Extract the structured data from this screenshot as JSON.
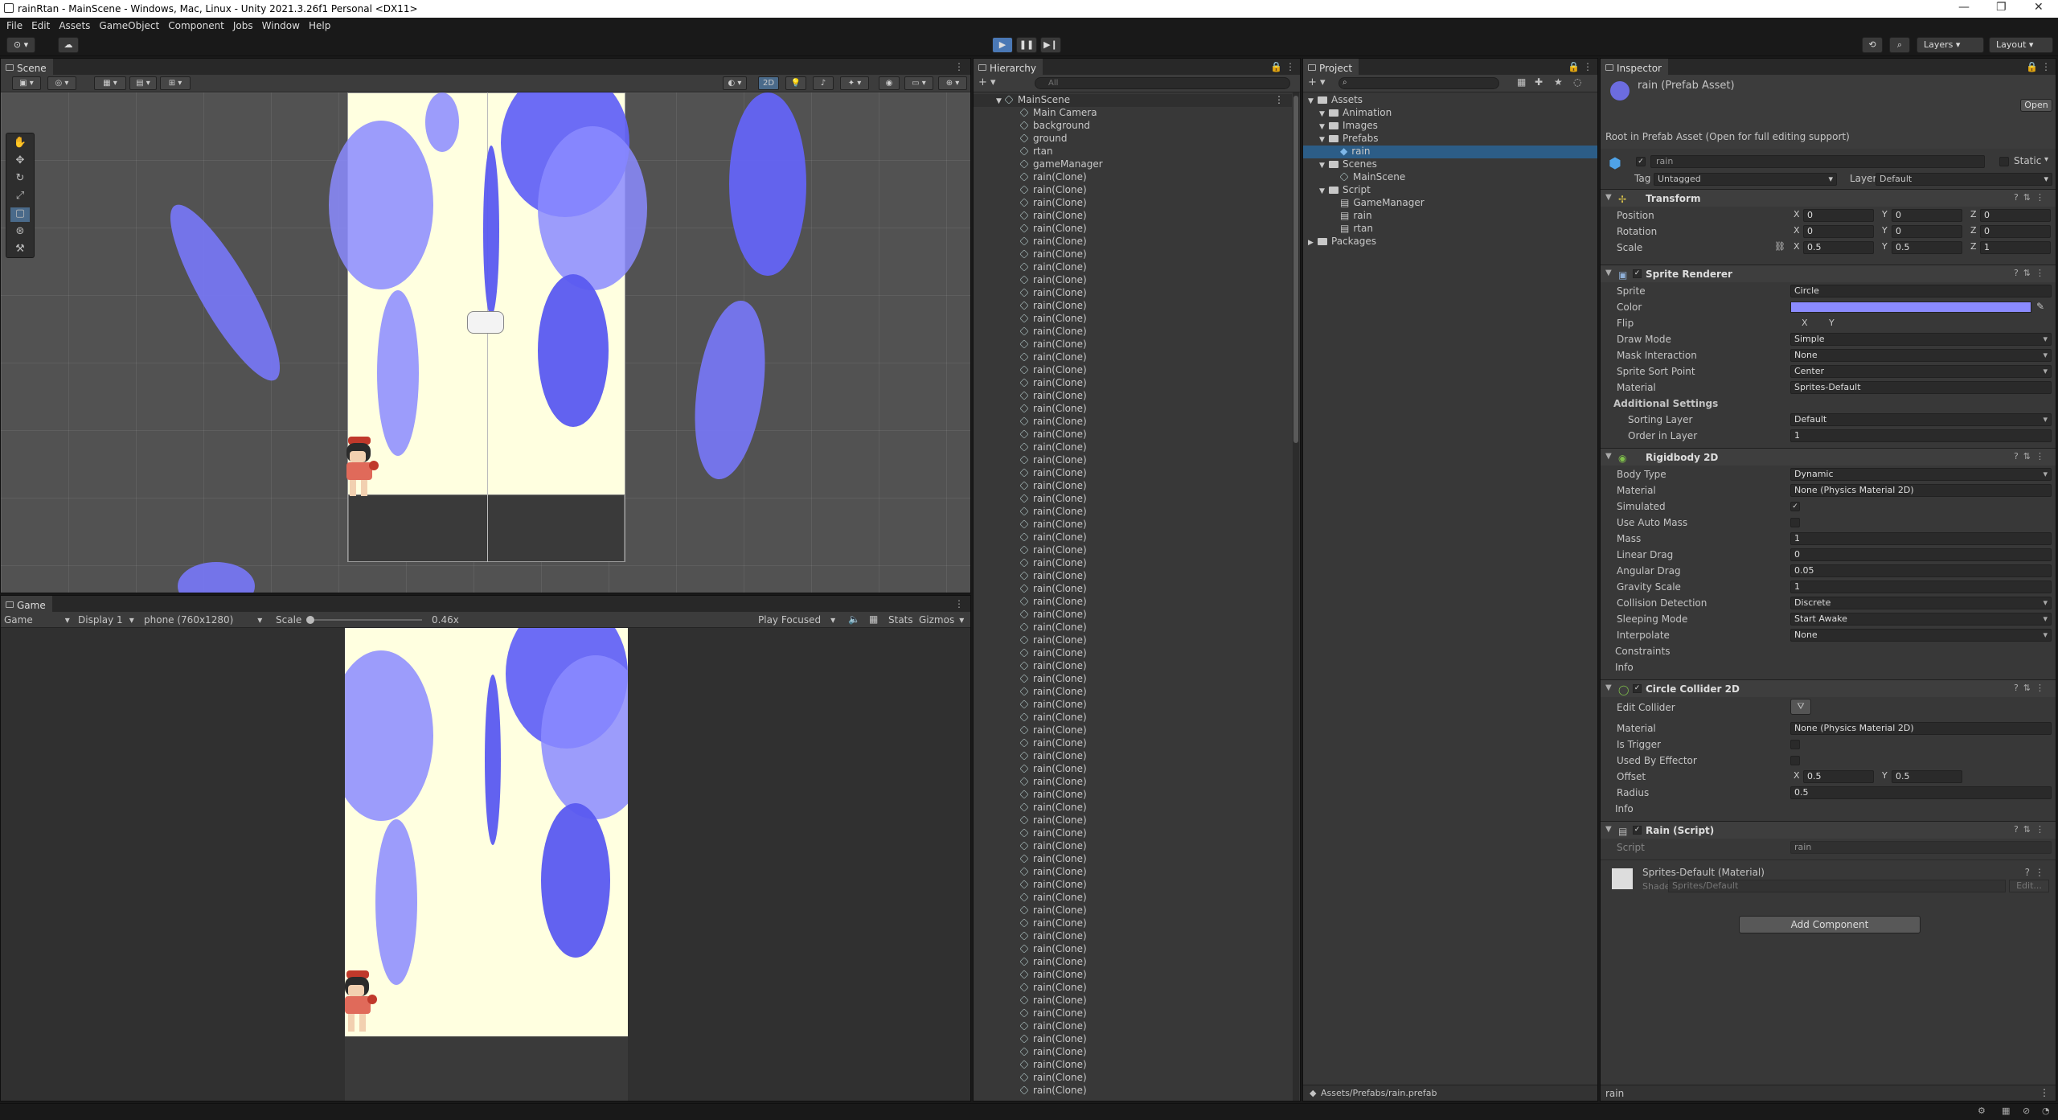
{
  "window": {
    "title": "rainRtan - MainScene - Windows, Mac, Linux - Unity 2021.3.26f1 Personal <DX11>"
  },
  "menu": [
    "File",
    "Edit",
    "Assets",
    "GameObject",
    "Component",
    "Jobs",
    "Window",
    "Help"
  ],
  "toolbar": {
    "layers": "Layers",
    "layout": "Layout"
  },
  "scene": {
    "tab": "Scene",
    "mode2d": "2D"
  },
  "game": {
    "tab": "Game",
    "view": "Game",
    "display": "Display 1",
    "resolution": "phone (760x1280)",
    "scale_label": "Scale",
    "scale_value": "0.46x",
    "play_mode": "Play Focused",
    "stats": "Stats",
    "gizmos": "Gizmos"
  },
  "hierarchy": {
    "tab": "Hierarchy",
    "search_placeholder": "All",
    "scene": "MainScene",
    "items": [
      "Main Camera",
      "background",
      "ground",
      "rtan",
      "gameManager"
    ],
    "clone_label": "rain(Clone)",
    "clone_count": 72
  },
  "project": {
    "tab": "Project",
    "tree": [
      {
        "label": "Assets",
        "depth": 0,
        "kind": "folder"
      },
      {
        "label": "Animation",
        "depth": 1,
        "kind": "folder"
      },
      {
        "label": "Images",
        "depth": 1,
        "kind": "folder"
      },
      {
        "label": "Prefabs",
        "depth": 1,
        "kind": "folder"
      },
      {
        "label": "rain",
        "depth": 2,
        "kind": "prefab",
        "selected": true
      },
      {
        "label": "Scenes",
        "depth": 1,
        "kind": "folder"
      },
      {
        "label": "MainScene",
        "depth": 2,
        "kind": "scene"
      },
      {
        "label": "Script",
        "depth": 1,
        "kind": "folder"
      },
      {
        "label": "GameManager",
        "depth": 2,
        "kind": "script"
      },
      {
        "label": "rain",
        "depth": 2,
        "kind": "script"
      },
      {
        "label": "rtan",
        "depth": 2,
        "kind": "script"
      },
      {
        "label": "Packages",
        "depth": 0,
        "kind": "folder"
      }
    ],
    "path": "Assets/Prefabs/rain.prefab"
  },
  "inspector": {
    "tab": "Inspector",
    "asset_title": "rain (Prefab Asset)",
    "open_btn": "Open",
    "root_note": "Root in Prefab Asset (Open for full editing support)",
    "name": "rain",
    "static_label": "Static",
    "tag_label": "Tag",
    "tag": "Untagged",
    "layer_label": "Layer",
    "layer": "Default",
    "transform": {
      "title": "Transform",
      "rows": [
        {
          "label": "Position",
          "x": "0",
          "y": "0",
          "z": "0"
        },
        {
          "label": "Rotation",
          "x": "0",
          "y": "0",
          "z": "0"
        },
        {
          "label": "Scale",
          "x": "0.5",
          "y": "0.5",
          "z": "1"
        }
      ]
    },
    "sprite_renderer": {
      "title": "Sprite Renderer",
      "sprite_label": "Sprite",
      "sprite": "Circle",
      "color_label": "Color",
      "color": "#8b8bff",
      "flip_label": "Flip",
      "flip_x": "X",
      "flip_y": "Y",
      "draw_mode_label": "Draw Mode",
      "draw_mode": "Simple",
      "mask_label": "Mask Interaction",
      "mask": "None",
      "sort_point_label": "Sprite Sort Point",
      "sort_point": "Center",
      "material_label": "Material",
      "material": "Sprites-Default",
      "additional": "Additional Settings",
      "sorting_layer_label": "Sorting Layer",
      "sorting_layer": "Default",
      "order_label": "Order in Layer",
      "order": "1"
    },
    "rigidbody": {
      "title": "Rigidbody 2D",
      "rows": [
        {
          "label": "Body Type",
          "value": "Dynamic",
          "kind": "dd"
        },
        {
          "label": "Material",
          "value": "None (Physics Material 2D)",
          "kind": "obj"
        },
        {
          "label": "Simulated",
          "value": "✓",
          "kind": "chk"
        },
        {
          "label": "Use Auto Mass",
          "value": "",
          "kind": "chk"
        },
        {
          "label": "Mass",
          "value": "1",
          "kind": "num"
        },
        {
          "label": "Linear Drag",
          "value": "0",
          "kind": "num"
        },
        {
          "label": "Angular Drag",
          "value": "0.05",
          "kind": "num"
        },
        {
          "label": "Gravity Scale",
          "value": "1",
          "kind": "num"
        },
        {
          "label": "Collision Detection",
          "value": "Discrete",
          "kind": "dd"
        },
        {
          "label": "Sleeping Mode",
          "value": "Start Awake",
          "kind": "dd"
        },
        {
          "label": "Interpolate",
          "value": "None",
          "kind": "dd"
        }
      ],
      "constraints": "Constraints",
      "info": "Info"
    },
    "circle_collider": {
      "title": "Circle Collider 2D",
      "edit_label": "Edit Collider",
      "material_label": "Material",
      "material": "None (Physics Material 2D)",
      "trigger_label": "Is Trigger",
      "effector_label": "Used By Effector",
      "offset_label": "Offset",
      "offset_x": "0.5",
      "offset_y": "0.5",
      "radius_label": "Radius",
      "radius": "0.5",
      "info": "Info"
    },
    "rain_script": {
      "title": "Rain (Script)",
      "script_label": "Script",
      "script": "rain"
    },
    "material": {
      "name": "Sprites-Default (Material)",
      "shader_label": "Shader",
      "shader": "Sprites/Default",
      "edit": "Edit..."
    },
    "add_component": "Add Component",
    "footer": "rain"
  }
}
